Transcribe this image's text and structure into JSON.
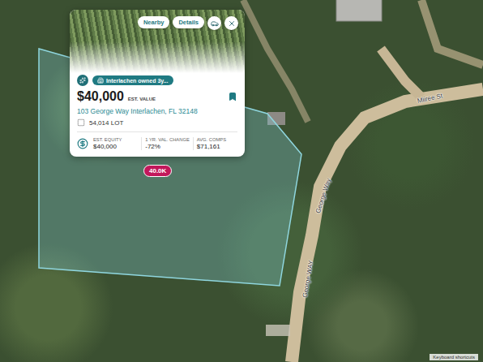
{
  "map": {
    "roads": [
      {
        "name": "Miiree St"
      },
      {
        "name": "George Way"
      },
      {
        "name": "George WAY"
      }
    ],
    "pin": {
      "label": "40.0K"
    },
    "attribution": "Keyboard shortcuts"
  },
  "popup": {
    "buttons": [
      "Nearby",
      "Details"
    ],
    "badge": "Interlachen owned 3y...",
    "price": "$40,000",
    "price_label": "EST. VALUE",
    "bookmarked": true,
    "address": "103 George Way Interlachen, FL 32148",
    "lot_size": "54,014",
    "lot_label": "LOT",
    "stats": [
      {
        "label": "EST. EQUITY",
        "value": "$40,000"
      },
      {
        "label": "1 YR. VAL. CHANGE",
        "value": "-72%"
      },
      {
        "label": "AVG. COMPS",
        "value": "$71,161"
      }
    ]
  }
}
